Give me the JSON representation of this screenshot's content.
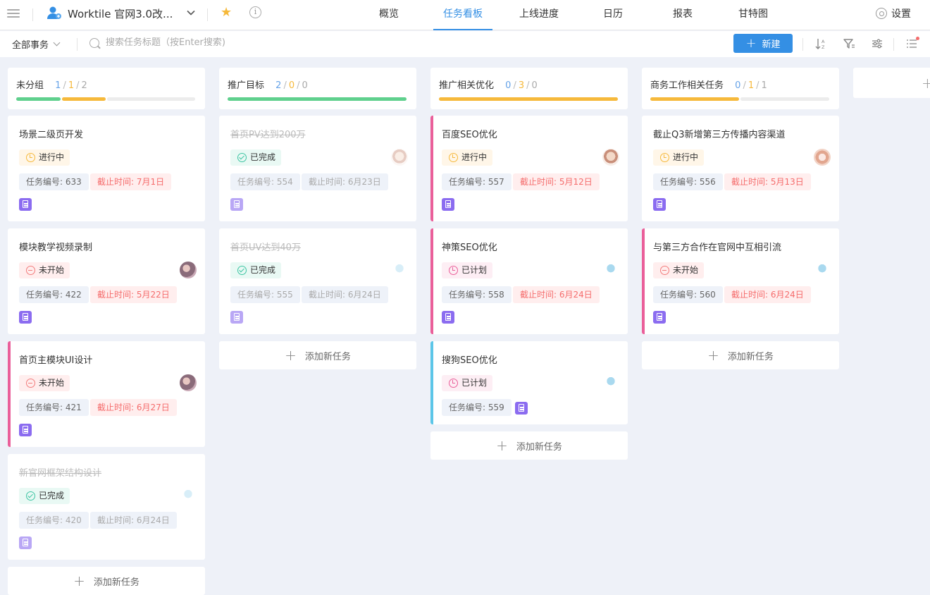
{
  "header": {
    "project_title": "Worktile 官网3.0改...",
    "tabs": [
      {
        "label": "概览"
      },
      {
        "label": "任务看板"
      },
      {
        "label": "上线进度"
      },
      {
        "label": "日历"
      },
      {
        "label": "报表"
      },
      {
        "label": "甘特图"
      }
    ],
    "settings_label": "设置"
  },
  "toolbar": {
    "filter_label": "全部事务",
    "search_placeholder": "搜索任务标题（按Enter搜索)",
    "new_label": "新建"
  },
  "colors": {
    "accent": "#348fe4",
    "in_progress": "#f6b93b",
    "not_started": "#f27c7c",
    "done": "#3ec5a3",
    "planned": "#ea5f9a",
    "progress_green": "#5fd08d",
    "clip_purple": "#8b6cf0"
  },
  "add_task_label": "添加新任务",
  "columns": [
    {
      "title": "未分组",
      "counts": [
        "1",
        "1",
        "2"
      ],
      "progress": {
        "done": 1,
        "in_progress": 1,
        "not_started": 2
      },
      "cards": [
        {
          "title": "场景二级页开发",
          "status": "进行中",
          "status_kind": "in-progress",
          "number_label": "任务编号: 633",
          "due_label": "截止时间: 7月1日",
          "avatar": "none",
          "done": false,
          "bar": "none"
        },
        {
          "title": "模块教学视频录制",
          "status": "未开始",
          "status_kind": "not-started",
          "number_label": "任务编号: 422",
          "due_label": "截止时间: 5月22日",
          "avatar": "photo",
          "done": false,
          "bar": "none"
        },
        {
          "title": "首页主模块UI设计",
          "status": "未开始",
          "status_kind": "not-started",
          "number_label": "任务编号: 421",
          "due_label": "截止时间: 6月27日",
          "avatar": "photo",
          "done": false,
          "bar": "pink"
        },
        {
          "title": "新官网框架结构设计",
          "status": "已完成",
          "status_kind": "done",
          "number_label": "任务编号: 420",
          "due_label": "截止时间: 6月24日",
          "avatar": "blue",
          "done": true,
          "bar": "none"
        }
      ]
    },
    {
      "title": "推广目标",
      "counts": [
        "2",
        "0",
        "0"
      ],
      "progress": {
        "done": 2,
        "in_progress": 0,
        "not_started": 0
      },
      "cards": [
        {
          "title": "首页PV达到200万",
          "status": "已完成",
          "status_kind": "done",
          "number_label": "任务编号: 554",
          "due_label": "截止时间: 6月23日",
          "avatar": "face",
          "done": true,
          "bar": "none"
        },
        {
          "title": "首页UV达到40万",
          "status": "已完成",
          "status_kind": "done",
          "number_label": "任务编号: 555",
          "due_label": "截止时间: 6月24日",
          "avatar": "blue",
          "done": true,
          "bar": "none"
        }
      ]
    },
    {
      "title": "推广相关优化",
      "counts": [
        "0",
        "3",
        "0"
      ],
      "progress": {
        "done": 0,
        "in_progress": 3,
        "not_started": 0
      },
      "cards": [
        {
          "title": "百度SEO优化",
          "status": "进行中",
          "status_kind": "in-progress",
          "number_label": "任务编号: 557",
          "due_label": "截止时间: 5月12日",
          "avatar": "face",
          "done": false,
          "bar": "pink"
        },
        {
          "title": "神策SEO优化",
          "status": "已计划",
          "status_kind": "planned",
          "number_label": "任务编号: 558",
          "due_label": "截止时间: 6月24日",
          "avatar": "blue",
          "done": false,
          "bar": "pink"
        },
        {
          "title": "搜狗SEO优化",
          "status": "已计划",
          "status_kind": "planned",
          "number_label": "任务编号: 559",
          "due_label": "",
          "avatar": "blue",
          "done": false,
          "bar": "cyan"
        }
      ]
    },
    {
      "title": "商务工作相关任务",
      "counts": [
        "0",
        "1",
        "1"
      ],
      "progress": {
        "done": 0,
        "in_progress": 1,
        "not_started": 1
      },
      "cards": [
        {
          "title": "截止Q3新增第三方传播内容渠道",
          "status": "进行中",
          "status_kind": "in-progress",
          "number_label": "任务编号: 556",
          "due_label": "截止时间: 5月13日",
          "avatar": "face2",
          "done": false,
          "bar": "none"
        },
        {
          "title": "与第三方合作在官网中互相引流",
          "status": "未开始",
          "status_kind": "not-started",
          "number_label": "任务编号: 560",
          "due_label": "截止时间: 6月24日",
          "avatar": "blue",
          "done": false,
          "bar": "pink"
        }
      ]
    }
  ]
}
